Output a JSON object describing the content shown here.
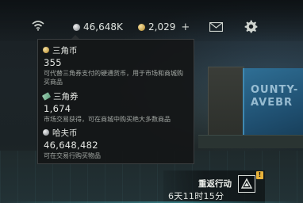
{
  "topbar": {
    "silver_balance": "46,648K",
    "gold_balance": "2,029",
    "plus_label": "+",
    "icons": {
      "wifi": "wifi-icon",
      "mail": "mail-icon",
      "settings": "gear-icon"
    }
  },
  "tooltip": {
    "items": [
      {
        "icon": "gold-coin-icon",
        "name": "三角币",
        "amount": "355",
        "desc_line1": "可代替三角券支付的硬通货币，用于市场和商城购",
        "desc_line2": "买商品"
      },
      {
        "icon": "ticket-icon",
        "name": "三角券",
        "amount": "1,674",
        "desc_line1": "市场交易获得，可在商城中购买绝大多数商品",
        "desc_line2": ""
      },
      {
        "icon": "silver-coin-icon",
        "name": "哈夫币",
        "amount": "46,648,482",
        "desc_line1": "可在交易行购买物品",
        "desc_line2": ""
      }
    ]
  },
  "background": {
    "poster_text_1": "OUNTY-",
    "poster_text_2": "AVEBR"
  },
  "event": {
    "title": "重返行动",
    "countdown": "6天11时15分",
    "badge": "!"
  },
  "colors": {
    "gold": "#c7a14c",
    "silver": "#9a9ea2",
    "ticket": "#5fa07c",
    "badge": "#e7b23a"
  }
}
